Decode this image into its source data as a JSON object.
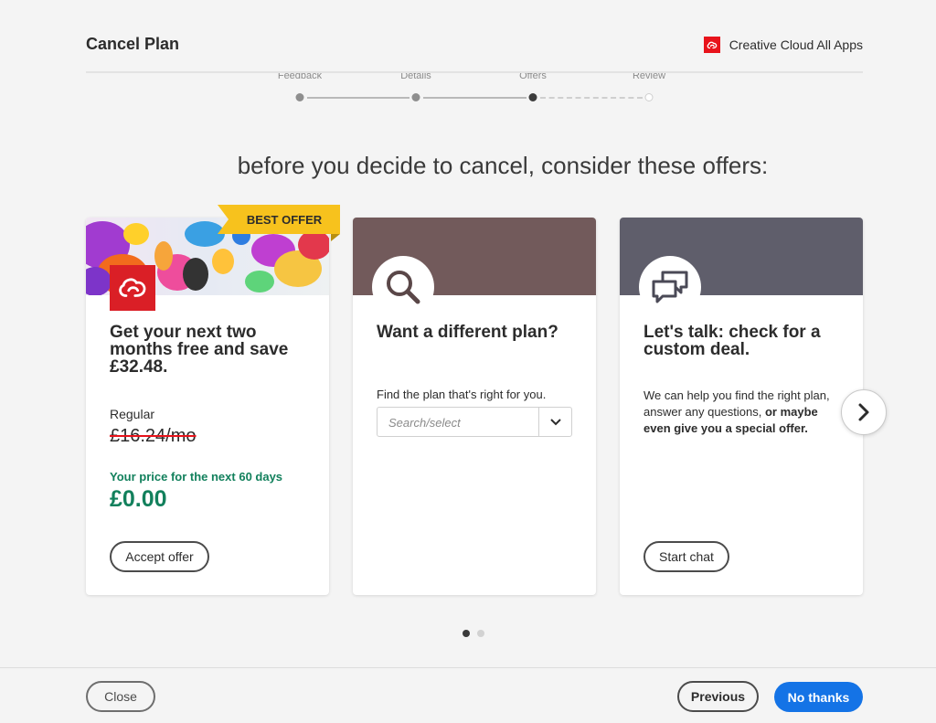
{
  "header": {
    "title": "Cancel Plan",
    "product_name": "Creative Cloud All Apps"
  },
  "stepper": {
    "steps": [
      {
        "label": "Feedback",
        "state": "done"
      },
      {
        "label": "Details",
        "state": "done"
      },
      {
        "label": "Offers",
        "state": "current"
      },
      {
        "label": "Review",
        "state": "future"
      }
    ]
  },
  "headline": "before you decide to cancel, consider these offers:",
  "cards": {
    "offer": {
      "badge": "BEST OFFER",
      "title": "Get your next two months free and save £32.48.",
      "regular_label": "Regular",
      "regular_price": "£16.24/mo",
      "promo_label": "Your price for the next 60 days",
      "promo_price": "£0.00",
      "button": "Accept offer"
    },
    "plan": {
      "icon": "search-icon",
      "title": "Want a different plan?",
      "find_label": "Find the plan that's right for you.",
      "select_placeholder": "Search/select"
    },
    "talk": {
      "icon": "chat-icon",
      "title": "Let's talk: check for a custom deal.",
      "body_normal": "We can help you find the right plan, answer any questions, ",
      "body_bold": "or maybe even give you a special offer.",
      "button": "Start chat"
    }
  },
  "carousel": {
    "page": 1,
    "total": 2
  },
  "footer": {
    "close": "Close",
    "previous": "Previous",
    "no_thanks": "No thanks"
  },
  "colors": {
    "brand_red": "#e8131b",
    "accent_blue": "#1473e6",
    "promo_green": "#12805c",
    "badge_yellow": "#f7c21d",
    "plan_banner": "#725a5b",
    "talk_banner": "#5f5e6b"
  }
}
